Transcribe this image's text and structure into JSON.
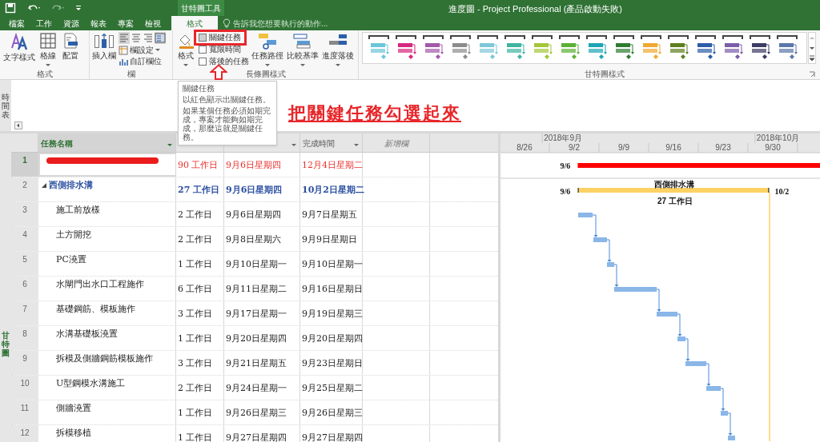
{
  "title_bar": {
    "title": "進度圖 - Project Professional (產品啟動失敗)",
    "context_label": "甘特圖工具"
  },
  "tabs": [
    {
      "label": "檔案",
      "selected": false
    },
    {
      "label": "工作",
      "selected": false
    },
    {
      "label": "資源",
      "selected": false
    },
    {
      "label": "報表",
      "selected": false
    },
    {
      "label": "專案",
      "selected": false
    },
    {
      "label": "檢視",
      "selected": false
    },
    {
      "label": "格式",
      "selected": true
    }
  ],
  "tell_me": {
    "placeholder": "告訴我您想要執行的動作..."
  },
  "format_group": {
    "label": "格式",
    "buttons": [
      "文字樣式",
      "格線",
      "配置"
    ]
  },
  "column_group": {
    "label": "欄",
    "insert": "插入欄",
    "settings": "欄設定",
    "custom": "自訂欄位"
  },
  "bar_styles_group": {
    "label": "長條圖樣式",
    "format": "格式",
    "checkboxes": [
      {
        "label": "關鍵任務",
        "checked": false
      },
      {
        "label": "寬限時間",
        "checked": false
      },
      {
        "label": "落後的任務",
        "checked": false
      }
    ],
    "buttons": [
      "任務路徑",
      "比較基準",
      "進度落後"
    ]
  },
  "gantt_styles_group": {
    "label": "甘特圖樣式",
    "styles": [
      {
        "color": "#6cc5d9"
      },
      {
        "color": "#d6287e"
      },
      {
        "color": "#a25aa8"
      },
      {
        "color": "#8c8c8c"
      },
      {
        "color": "#7cc8d8"
      },
      {
        "color": "#3fb5a0"
      },
      {
        "color": "#a4c639"
      },
      {
        "color": "#5bb135"
      },
      {
        "color": "#1ea5b5"
      },
      {
        "color": "#2e7d32"
      },
      {
        "color": "#f0a830"
      },
      {
        "color": "#5d7f1e"
      },
      {
        "color": "#2e5da8"
      },
      {
        "color": "#7a5ea8"
      },
      {
        "color": "#3c3c64"
      },
      {
        "color": "#5a78a8"
      }
    ]
  },
  "timeline": {
    "label": "時間表"
  },
  "tooltip": {
    "title": "關鍵任務",
    "lines": [
      "以紅色顯示出關鍵任務。",
      "如果某個任務必須如期完成，專案才能夠如期完成，那麼這就是關鍵任務。"
    ]
  },
  "annotation": {
    "text": "把關鍵任務勾選起來"
  },
  "view_label": "甘特圖",
  "table": {
    "columns": {
      "name": "任務名稱",
      "finish": "完成時間",
      "add": "新增欄"
    },
    "rows": [
      {
        "id": "1",
        "kind": "critical",
        "redacted": true,
        "selected": true,
        "duration": "90 工作日",
        "start": "9月6日星期四",
        "finish": "12月4日星期二"
      },
      {
        "id": "2",
        "kind": "summary",
        "redacted": false,
        "selected": false,
        "expanded": true,
        "name": "西側排水溝",
        "duration": "27 工作日",
        "start": "9月6日星期四",
        "finish": "10月2日星期二"
      },
      {
        "id": "3",
        "kind": "task",
        "redacted": false,
        "selected": false,
        "name": "施工前放樣",
        "duration": "2 工作日",
        "start": "9月6日星期四",
        "finish": "9月7日星期五"
      },
      {
        "id": "4",
        "kind": "task",
        "redacted": false,
        "selected": false,
        "name": "土方開挖",
        "duration": "2 工作日",
        "start": "9月8日星期六",
        "finish": "9月9日星期日"
      },
      {
        "id": "5",
        "kind": "task",
        "redacted": false,
        "selected": false,
        "name": "PC澆置",
        "duration": "1 工作日",
        "start": "9月10日星期一",
        "finish": "9月10日星期一"
      },
      {
        "id": "6",
        "kind": "task",
        "redacted": false,
        "selected": false,
        "name": "水閘門出水口工程施作",
        "duration": "6 工作日",
        "start": "9月11日星期二",
        "finish": "9月16日星期日"
      },
      {
        "id": "7",
        "kind": "task",
        "redacted": false,
        "selected": false,
        "name": "基礎鋼筋、模板施作",
        "duration": "3 工作日",
        "start": "9月17日星期一",
        "finish": "9月19日星期三"
      },
      {
        "id": "8",
        "kind": "task",
        "redacted": false,
        "selected": false,
        "name": "水溝基礎板澆置",
        "duration": "1 工作日",
        "start": "9月20日星期四",
        "finish": "9月20日星期四"
      },
      {
        "id": "9",
        "kind": "task",
        "redacted": false,
        "selected": false,
        "name": "拆模及側牆鋼筋模板施作",
        "duration": "3 工作日",
        "start": "9月21日星期五",
        "finish": "9月23日星期日"
      },
      {
        "id": "10",
        "kind": "task",
        "redacted": false,
        "selected": false,
        "name": "U型鋼模水溝施工",
        "duration": "2 工作日",
        "start": "9月24日星期一",
        "finish": "9月25日星期二"
      },
      {
        "id": "11",
        "kind": "task",
        "redacted": false,
        "selected": false,
        "name": "側牆澆置",
        "duration": "1 工作日",
        "start": "9月26日星期三",
        "finish": "9月26日星期三"
      },
      {
        "id": "12",
        "kind": "task",
        "redacted": false,
        "selected": false,
        "name": "拆模移植",
        "duration": "1 工作日",
        "start": "9月27日星期四",
        "finish": "9月27日星期四"
      }
    ]
  },
  "gantt": {
    "months": [
      "2018年9月",
      "2018年10月"
    ],
    "weeks": [
      "8/26",
      "9/2",
      "9/9",
      "9/16",
      "9/23",
      "9/30"
    ],
    "critical_start": "9/6",
    "summary_name": "西側排水溝",
    "summary_start": "9/6",
    "summary_finish": "10/2",
    "summary_duration": "27 工作日"
  }
}
